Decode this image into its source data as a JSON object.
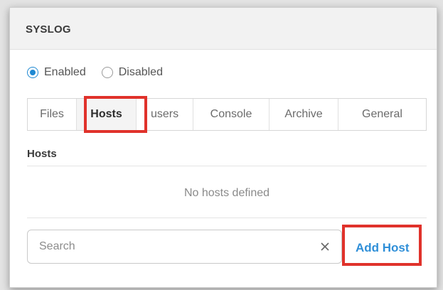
{
  "panel": {
    "title": "SYSLOG"
  },
  "status": {
    "options": [
      {
        "label": "Enabled",
        "checked": true
      },
      {
        "label": "Disabled",
        "checked": false
      }
    ]
  },
  "tabs": [
    {
      "label": "Files",
      "active": false
    },
    {
      "label": "Hosts",
      "active": true
    },
    {
      "label": "users",
      "active": false
    },
    {
      "label": "Console",
      "active": false
    },
    {
      "label": "Archive",
      "active": false
    },
    {
      "label": "General",
      "active": false
    }
  ],
  "hosts": {
    "section_title": "Hosts",
    "empty_message": "No hosts defined"
  },
  "search": {
    "placeholder": "Search",
    "value": ""
  },
  "actions": {
    "add_host_label": "Add Host"
  },
  "colors": {
    "accent": "#1e88d2",
    "link": "#2f8fd8",
    "highlight": "#e0322b"
  },
  "icons": {
    "clear": "close-icon"
  }
}
